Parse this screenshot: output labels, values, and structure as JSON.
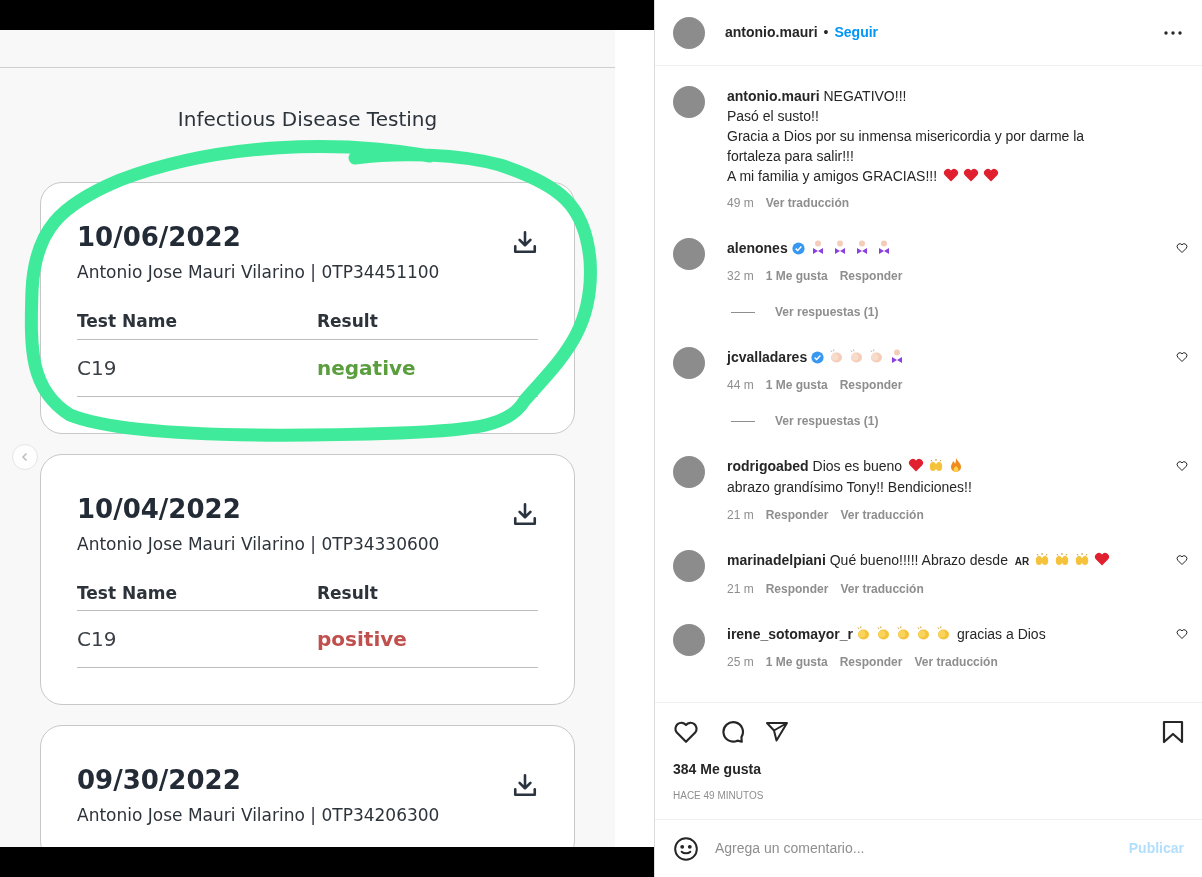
{
  "post_image": {
    "title": "Infectious Disease Testing",
    "records": [
      {
        "date": "10/06/2022",
        "patient": "Antonio Jose Mauri Vilarino | 0TP34451100",
        "headers": [
          "Test Name",
          "Result"
        ],
        "rows": [
          {
            "test": "C19",
            "result": "negative",
            "color": "#5a9e3d"
          }
        ]
      },
      {
        "date": "10/04/2022",
        "patient": "Antonio Jose Mauri Vilarino | 0TP34330600",
        "headers": [
          "Test Name",
          "Result"
        ],
        "rows": [
          {
            "test": "C19",
            "result": "positive",
            "color": "#c0504d"
          }
        ]
      },
      {
        "date": "09/30/2022",
        "patient": "Antonio Jose Mauri Vilarino | 0TP34206300"
      }
    ]
  },
  "header": {
    "username": "antonio.mauri",
    "separator": "•",
    "follow": "Seguir"
  },
  "caption": {
    "username": "antonio.mauri",
    "lines": [
      [
        {
          "kind": "text",
          "text": "NEGATIVO!!!"
        }
      ],
      [
        {
          "kind": "text",
          "text": "Pasó el susto!!"
        }
      ],
      [
        {
          "kind": "text",
          "text": "Gracia a Dios por su inmensa misericordia y por darme la fortaleza para salir!!!"
        }
      ],
      [
        {
          "kind": "text",
          "text": "A mi familia y amigos GRACIAS!!!"
        },
        {
          "kind": "heart"
        },
        {
          "kind": "heart"
        },
        {
          "kind": "heart"
        }
      ]
    ],
    "time": "49 m",
    "translate": "Ver traducción"
  },
  "comments": [
    {
      "username": "alenones",
      "verified": true,
      "body": [
        {
          "kind": "figure"
        },
        {
          "kind": "figure"
        },
        {
          "kind": "figure"
        },
        {
          "kind": "figure"
        }
      ],
      "time": "32 m",
      "likes": "1 Me gusta",
      "reply": "Responder",
      "replies": "Ver respuestas (1)"
    },
    {
      "username": "jcvalladares",
      "verified": true,
      "body": [
        {
          "kind": "clap-light"
        },
        {
          "kind": "clap-light"
        },
        {
          "kind": "clap-light"
        },
        {
          "kind": "figure"
        }
      ],
      "time": "44 m",
      "likes": "1 Me gusta",
      "reply": "Responder",
      "replies": "Ver respuestas (1)"
    },
    {
      "username": "rodrigoabed",
      "verified": false,
      "body": [
        {
          "kind": "text",
          "text": "Dios es bueno"
        },
        {
          "kind": "heart"
        },
        {
          "kind": "raised-hands"
        },
        {
          "kind": "fire"
        },
        {
          "kind": "text",
          "text": "abrazo grandísimo Tony!!"
        },
        {
          "kind": "text",
          "text": "Bendiciones!!"
        }
      ],
      "time": "21 m",
      "reply": "Responder",
      "translate": "Ver traducción"
    },
    {
      "username": "marinadelpiani",
      "verified": false,
      "body": [
        {
          "kind": "text",
          "text": "Qué bueno!!!!! Abrazo desde"
        },
        {
          "kind": "flag",
          "text": "AR"
        },
        {
          "kind": "raised-hands"
        },
        {
          "kind": "raised-hands"
        },
        {
          "kind": "raised-hands"
        },
        {
          "kind": "heart"
        }
      ],
      "time": "21 m",
      "reply": "Responder",
      "translate": "Ver traducción"
    },
    {
      "username": "irene_sotomayor_r",
      "verified": false,
      "body": [
        {
          "kind": "clap"
        },
        {
          "kind": "clap"
        },
        {
          "kind": "clap"
        },
        {
          "kind": "clap"
        },
        {
          "kind": "clap"
        },
        {
          "kind": "text",
          "text": "gracias a Dios"
        }
      ],
      "time": "25 m",
      "likes": "1 Me gusta",
      "reply": "Responder",
      "translate": "Ver traducción"
    }
  ],
  "likes": "384 Me gusta",
  "posted": "HACE 49 MINUTOS",
  "comment_box": {
    "placeholder": "Agrega un comentario...",
    "submit": "Publicar"
  }
}
